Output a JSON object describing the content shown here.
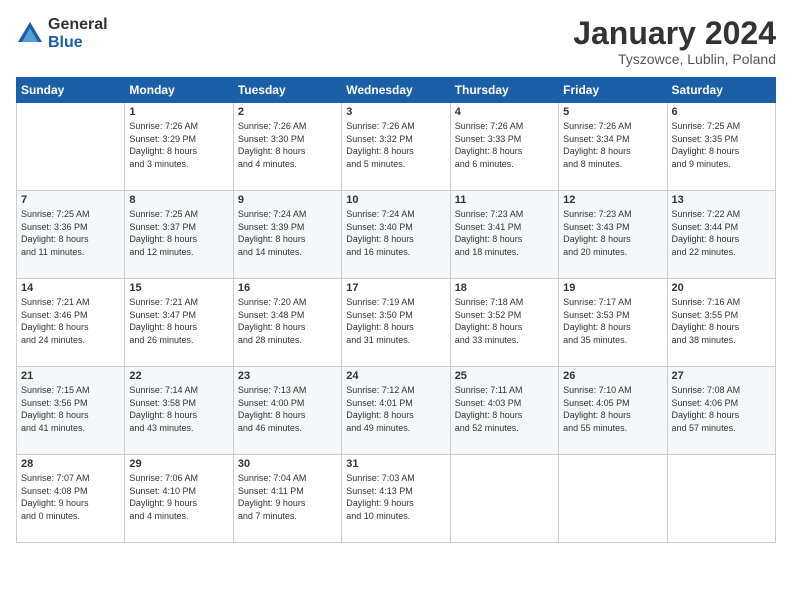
{
  "logo": {
    "general": "General",
    "blue": "Blue"
  },
  "header": {
    "title": "January 2024",
    "location": "Tyszowce, Lublin, Poland"
  },
  "weekdays": [
    "Sunday",
    "Monday",
    "Tuesday",
    "Wednesday",
    "Thursday",
    "Friday",
    "Saturday"
  ],
  "weeks": [
    [
      {
        "day": null,
        "sunrise": null,
        "sunset": null,
        "daylight": null
      },
      {
        "day": "1",
        "sunrise": "Sunrise: 7:26 AM",
        "sunset": "Sunset: 3:29 PM",
        "daylight": "Daylight: 8 hours and 3 minutes."
      },
      {
        "day": "2",
        "sunrise": "Sunrise: 7:26 AM",
        "sunset": "Sunset: 3:30 PM",
        "daylight": "Daylight: 8 hours and 4 minutes."
      },
      {
        "day": "3",
        "sunrise": "Sunrise: 7:26 AM",
        "sunset": "Sunset: 3:32 PM",
        "daylight": "Daylight: 8 hours and 5 minutes."
      },
      {
        "day": "4",
        "sunrise": "Sunrise: 7:26 AM",
        "sunset": "Sunset: 3:33 PM",
        "daylight": "Daylight: 8 hours and 6 minutes."
      },
      {
        "day": "5",
        "sunrise": "Sunrise: 7:26 AM",
        "sunset": "Sunset: 3:34 PM",
        "daylight": "Daylight: 8 hours and 8 minutes."
      },
      {
        "day": "6",
        "sunrise": "Sunrise: 7:25 AM",
        "sunset": "Sunset: 3:35 PM",
        "daylight": "Daylight: 8 hours and 9 minutes."
      }
    ],
    [
      {
        "day": "7",
        "sunrise": "Sunrise: 7:25 AM",
        "sunset": "Sunset: 3:36 PM",
        "daylight": "Daylight: 8 hours and 11 minutes."
      },
      {
        "day": "8",
        "sunrise": "Sunrise: 7:25 AM",
        "sunset": "Sunset: 3:37 PM",
        "daylight": "Daylight: 8 hours and 12 minutes."
      },
      {
        "day": "9",
        "sunrise": "Sunrise: 7:24 AM",
        "sunset": "Sunset: 3:39 PM",
        "daylight": "Daylight: 8 hours and 14 minutes."
      },
      {
        "day": "10",
        "sunrise": "Sunrise: 7:24 AM",
        "sunset": "Sunset: 3:40 PM",
        "daylight": "Daylight: 8 hours and 16 minutes."
      },
      {
        "day": "11",
        "sunrise": "Sunrise: 7:23 AM",
        "sunset": "Sunset: 3:41 PM",
        "daylight": "Daylight: 8 hours and 18 minutes."
      },
      {
        "day": "12",
        "sunrise": "Sunrise: 7:23 AM",
        "sunset": "Sunset: 3:43 PM",
        "daylight": "Daylight: 8 hours and 20 minutes."
      },
      {
        "day": "13",
        "sunrise": "Sunrise: 7:22 AM",
        "sunset": "Sunset: 3:44 PM",
        "daylight": "Daylight: 8 hours and 22 minutes."
      }
    ],
    [
      {
        "day": "14",
        "sunrise": "Sunrise: 7:21 AM",
        "sunset": "Sunset: 3:46 PM",
        "daylight": "Daylight: 8 hours and 24 minutes."
      },
      {
        "day": "15",
        "sunrise": "Sunrise: 7:21 AM",
        "sunset": "Sunset: 3:47 PM",
        "daylight": "Daylight: 8 hours and 26 minutes."
      },
      {
        "day": "16",
        "sunrise": "Sunrise: 7:20 AM",
        "sunset": "Sunset: 3:48 PM",
        "daylight": "Daylight: 8 hours and 28 minutes."
      },
      {
        "day": "17",
        "sunrise": "Sunrise: 7:19 AM",
        "sunset": "Sunset: 3:50 PM",
        "daylight": "Daylight: 8 hours and 31 minutes."
      },
      {
        "day": "18",
        "sunrise": "Sunrise: 7:18 AM",
        "sunset": "Sunset: 3:52 PM",
        "daylight": "Daylight: 8 hours and 33 minutes."
      },
      {
        "day": "19",
        "sunrise": "Sunrise: 7:17 AM",
        "sunset": "Sunset: 3:53 PM",
        "daylight": "Daylight: 8 hours and 35 minutes."
      },
      {
        "day": "20",
        "sunrise": "Sunrise: 7:16 AM",
        "sunset": "Sunset: 3:55 PM",
        "daylight": "Daylight: 8 hours and 38 minutes."
      }
    ],
    [
      {
        "day": "21",
        "sunrise": "Sunrise: 7:15 AM",
        "sunset": "Sunset: 3:56 PM",
        "daylight": "Daylight: 8 hours and 41 minutes."
      },
      {
        "day": "22",
        "sunrise": "Sunrise: 7:14 AM",
        "sunset": "Sunset: 3:58 PM",
        "daylight": "Daylight: 8 hours and 43 minutes."
      },
      {
        "day": "23",
        "sunrise": "Sunrise: 7:13 AM",
        "sunset": "Sunset: 4:00 PM",
        "daylight": "Daylight: 8 hours and 46 minutes."
      },
      {
        "day": "24",
        "sunrise": "Sunrise: 7:12 AM",
        "sunset": "Sunset: 4:01 PM",
        "daylight": "Daylight: 8 hours and 49 minutes."
      },
      {
        "day": "25",
        "sunrise": "Sunrise: 7:11 AM",
        "sunset": "Sunset: 4:03 PM",
        "daylight": "Daylight: 8 hours and 52 minutes."
      },
      {
        "day": "26",
        "sunrise": "Sunrise: 7:10 AM",
        "sunset": "Sunset: 4:05 PM",
        "daylight": "Daylight: 8 hours and 55 minutes."
      },
      {
        "day": "27",
        "sunrise": "Sunrise: 7:08 AM",
        "sunset": "Sunset: 4:06 PM",
        "daylight": "Daylight: 8 hours and 57 minutes."
      }
    ],
    [
      {
        "day": "28",
        "sunrise": "Sunrise: 7:07 AM",
        "sunset": "Sunset: 4:08 PM",
        "daylight": "Daylight: 9 hours and 0 minutes."
      },
      {
        "day": "29",
        "sunrise": "Sunrise: 7:06 AM",
        "sunset": "Sunset: 4:10 PM",
        "daylight": "Daylight: 9 hours and 4 minutes."
      },
      {
        "day": "30",
        "sunrise": "Sunrise: 7:04 AM",
        "sunset": "Sunset: 4:11 PM",
        "daylight": "Daylight: 9 hours and 7 minutes."
      },
      {
        "day": "31",
        "sunrise": "Sunrise: 7:03 AM",
        "sunset": "Sunset: 4:13 PM",
        "daylight": "Daylight: 9 hours and 10 minutes."
      },
      {
        "day": null,
        "sunrise": null,
        "sunset": null,
        "daylight": null
      },
      {
        "day": null,
        "sunrise": null,
        "sunset": null,
        "daylight": null
      },
      {
        "day": null,
        "sunrise": null,
        "sunset": null,
        "daylight": null
      }
    ]
  ]
}
